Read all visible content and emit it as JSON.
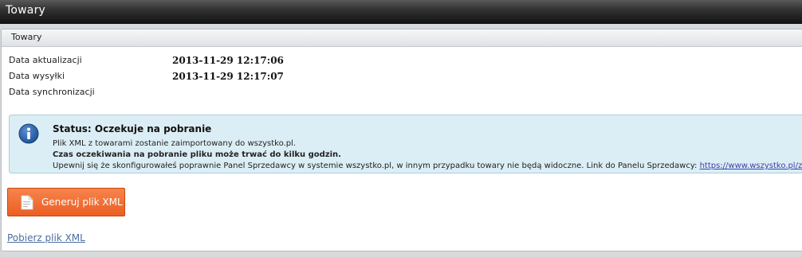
{
  "window": {
    "title": "Towary"
  },
  "panel": {
    "header": "Towary",
    "rows": [
      {
        "label": "Data aktualizacji",
        "value": "2013-11-29 12:17:06"
      },
      {
        "label": "Data wysyłki",
        "value": "2013-11-29 12:17:07"
      },
      {
        "label": "Data synchronizacji",
        "value": ""
      }
    ]
  },
  "notice": {
    "icon": "info-icon",
    "title": "Status: Oczekuje na pobranie",
    "line1": "Plik XML z towarami zostanie zaimportowany do wszystko.pl.",
    "line2": "Czas oczekiwania na pobranie pliku może trwać do kilku godzin.",
    "line3_text": "Upewnij się że skonfigurowałeś poprawnie Panel Sprzedawcy w systemie wszystko.pl, w innym przypadku towary nie będą widoczne. Link do Panelu Sprzedawcy: ",
    "line3_link": "https://www.wszystko.pl/zaloguj"
  },
  "actions": {
    "generate_button": "Generuj plik XML",
    "generate_icon": "document-icon",
    "download_link": "Pobierz plik XML"
  },
  "colors": {
    "button_orange": "#ec5e22",
    "notice_bg": "#dceef5",
    "link": "#4a6ea0"
  }
}
